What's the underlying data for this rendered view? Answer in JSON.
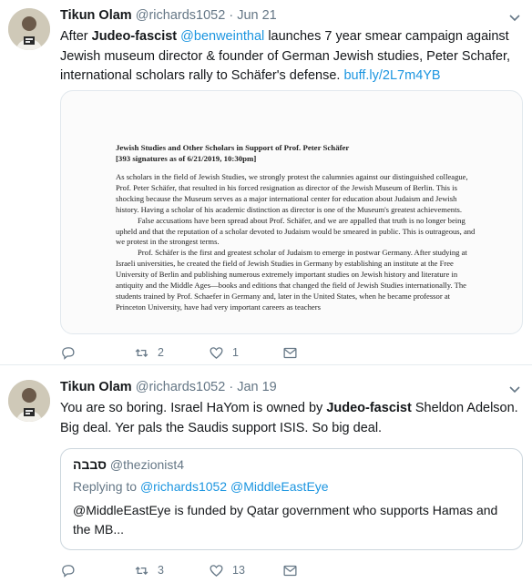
{
  "tweets": [
    {
      "name": "Tikun Olam",
      "handle": "@richards1052",
      "separator": "·",
      "date": "Jun 21",
      "text": {
        "a": "After ",
        "b": "Judeo-fascist",
        "c": " ",
        "mention": "@benweinthal",
        "d": " launches 7 year smear campaign against Jewish museum director & founder of German Jewish studies, Peter Schafer, international scholars rally to  Schäfer's defense. ",
        "url": "buff.ly/2L7m4YB"
      },
      "media": {
        "title_line1": "Jewish Studies and Other Scholars in Support of Prof. Peter Schäfer",
        "title_line2": "[393 signatures as of 6/21/2019, 10:30pm]",
        "p1": "As scholars in the field of Jewish Studies, we strongly protest the calumnies against our distinguished colleague, Prof. Peter Schäfer, that resulted in his forced resignation as director of the Jewish Museum of Berlin. This is shocking because the Museum serves as a major international center for education about Judaism and Jewish history. Having a scholar of his academic distinction as director is one of the Museum's greatest achievements.",
        "p2": "False accusations have been spread about Prof. Schäfer, and we are appalled that truth is no longer being upheld and that the reputation of a scholar devoted to Judaism would be smeared in public. This is outrageous, and we protest in the strongest terms.",
        "p3": "Prof. Schäfer is the first and greatest scholar of Judaism to emerge in postwar Germany. After studying at Israeli universities, he created the field of Jewish Studies in Germany by establishing an institute at the Free University of Berlin and publishing numerous extremely important studies on Jewish history and literature in antiquity and the Middle Ages—books and editions that changed the field of Jewish Studies internationally. The students trained by Prof. Schaefer in Germany and, later in the United States, when he became professor at Princeton University, have had very important careers as teachers"
      },
      "actions": {
        "replies": "",
        "retweets": "2",
        "likes": "1"
      }
    },
    {
      "name": "Tikun Olam",
      "handle": "@richards1052",
      "separator": "·",
      "date": "Jan 19",
      "text": {
        "a": "You are so boring. Israel HaYom is owned by ",
        "b": "Judeo-fascist",
        "c": " Sheldon Adelson. Big deal.  Yer pals the Saudis support ISIS. So big deal."
      },
      "quote": {
        "name": "סבבה",
        "handle": "@thezionist4",
        "reply_prefix": "Replying to ",
        "reply_to": "@richards1052 @MiddleEastEye",
        "text": "@MiddleEastEye is funded by Qatar government who supports Hamas and the MB..."
      },
      "actions": {
        "replies": "",
        "retweets": "3",
        "likes": "13"
      }
    }
  ],
  "colors": {
    "link": "#1b95e0",
    "muted": "#657786",
    "text": "#14171a",
    "border": "#e6ecf0"
  },
  "icons": [
    "reply-icon",
    "retweet-icon",
    "like-icon",
    "dm-icon",
    "caret-down-icon",
    "avatar"
  ]
}
